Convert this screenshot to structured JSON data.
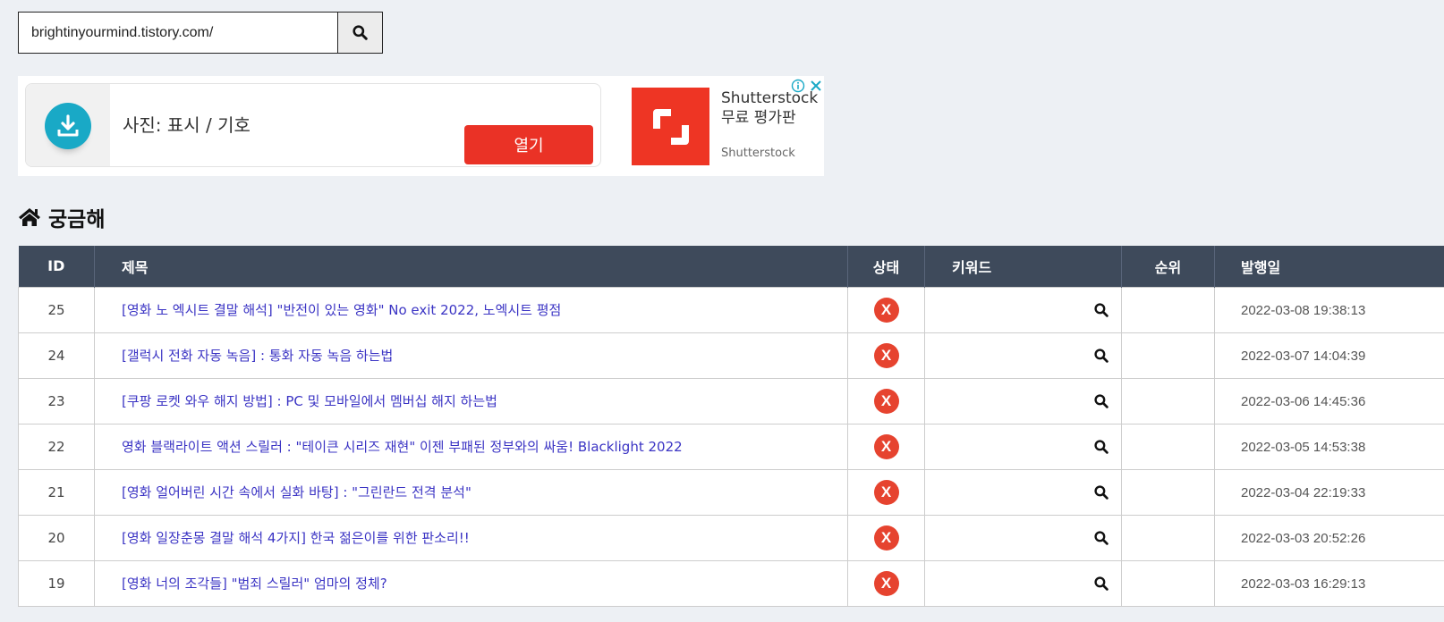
{
  "search": {
    "value": "brightinyourmind.tistory.com/",
    "icon": "search-icon"
  },
  "ad": {
    "card_title": "사진: 표시 / 기호",
    "open_label": "열기",
    "brand_line1": "Shutterstock",
    "brand_line2": "무료 평가판",
    "advertiser": "Shutterstock",
    "colors": {
      "download_circle": "#19a9c6",
      "open_button": "#ea3226",
      "logo_bg": "#ee3524",
      "ad_choices": "#19a9c6"
    }
  },
  "heading": {
    "icon": "home-icon",
    "title": "궁금해"
  },
  "table": {
    "headers": {
      "id": "ID",
      "title": "제목",
      "status": "상태",
      "keyword": "키워드",
      "rank": "순위",
      "date": "발행일"
    },
    "status_symbol": "X",
    "rows": [
      {
        "id": "25",
        "title": "[영화 노 엑시트 결말 해석] \"반전이 있는 영화\" No exit 2022, 노엑시트 평점",
        "keyword": "",
        "rank": "",
        "date": "2022-03-08 19:38:13"
      },
      {
        "id": "24",
        "title": "[갤럭시 전화 자동 녹음] : 통화 자동 녹음 하는법",
        "keyword": "",
        "rank": "",
        "date": "2022-03-07 14:04:39"
      },
      {
        "id": "23",
        "title": "[쿠팡 로켓 와우 해지 방법] : PC 및 모바일에서 멤버십 해지 하는법",
        "keyword": "",
        "rank": "",
        "date": "2022-03-06 14:45:36"
      },
      {
        "id": "22",
        "title": "영화 블랙라이트 액션 스릴러 : \"테이큰 시리즈 재현\" 이젠 부패된 정부와의 싸움! Blacklight 2022",
        "keyword": "",
        "rank": "",
        "date": "2022-03-05 14:53:38"
      },
      {
        "id": "21",
        "title": "[영화 얼어버린 시간 속에서 실화 바탕] : \"그린란드 전격 분석\"",
        "keyword": "",
        "rank": "",
        "date": "2022-03-04 22:19:33"
      },
      {
        "id": "20",
        "title": "[영화 일장춘몽 결말 해석 4가지] 한국 젊은이를 위한 판소리!!",
        "keyword": "",
        "rank": "",
        "date": "2022-03-03 20:52:26"
      },
      {
        "id": "19",
        "title": "[영화 너의 조각들] \"범죄 스릴러\" 엄마의 정체?",
        "keyword": "",
        "rank": "",
        "date": "2022-03-03 16:29:13"
      }
    ],
    "colors": {
      "header_bg": "#3e4a5b",
      "link": "#3b34c4",
      "status_bg": "#e6432f"
    }
  }
}
